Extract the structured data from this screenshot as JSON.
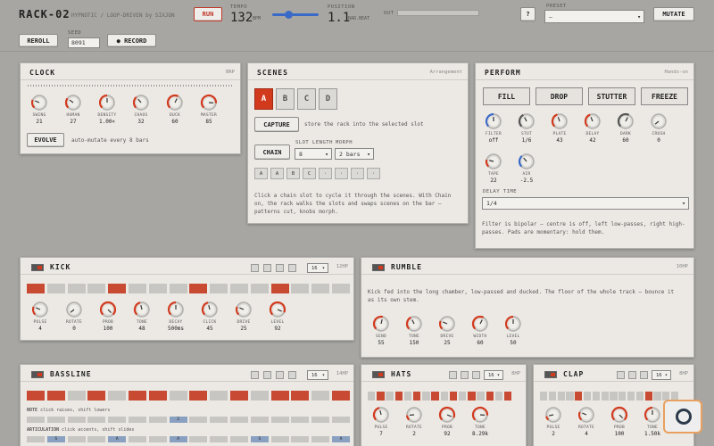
{
  "header": {
    "title": "RACK-02",
    "subtitle": "HYPNOTIC / LOOP-DRIVEN by SIXJON",
    "run_label": "RUN",
    "tempo_label": "TEMPO",
    "tempo_value": "132",
    "tempo_unit": "BPM",
    "position_label": "POSITION",
    "position_value": "1.1",
    "position_unit": "BAR.BEAT",
    "out_label": "OUT",
    "help_label": "?",
    "preset_label": "PRESET",
    "preset_value": "—",
    "mutate_label": "MUTATE",
    "reroll_label": "REROLL",
    "seed_label": "SEED",
    "seed_value": "8091",
    "record_label": "● RECORD"
  },
  "clock": {
    "title": "CLOCK",
    "tag": "BRP",
    "knobs": [
      {
        "label": "SWING",
        "value": "21",
        "level": 0.25
      },
      {
        "label": "HUMAN",
        "value": "27",
        "level": 0.3
      },
      {
        "label": "DENSITY",
        "value": "1.00×",
        "level": 0.5
      },
      {
        "label": "CHAOS",
        "value": "32",
        "level": 0.35
      },
      {
        "label": "DUCK",
        "value": "60",
        "level": 0.6
      },
      {
        "label": "MASTER",
        "value": "85",
        "level": 0.85
      }
    ],
    "evolve_label": "EVOLVE",
    "evolve_text": "auto-mutate every 8 bars"
  },
  "scenes": {
    "title": "SCENES",
    "tag": "Arrangement",
    "buttons": [
      "A",
      "B",
      "C",
      "D"
    ],
    "capture_label": "CAPTURE",
    "capture_text": "store the rack into the selected slot",
    "chain_label": "CHAIN",
    "slot_length_label": "SLOT LENGTH",
    "slot_length_value": "8",
    "morph_label": "MORPH",
    "morph_value": "2 bars",
    "slots": [
      "A",
      "A",
      "B",
      "C",
      "·",
      "·",
      "·",
      "·"
    ],
    "help": "Click a chain slot to cycle it through the scenes. With Chain on, the rack walks the slots and swaps scenes on the bar — patterns cut, knobs morph."
  },
  "perform": {
    "title": "PERFORM",
    "tag": "Hands-on",
    "pads": [
      "FILL",
      "DROP",
      "STUTTER",
      "FREEZE"
    ],
    "knobs": [
      {
        "label": "FILTER",
        "value": "off",
        "level": 0.5,
        "color": "#3a6ac8"
      },
      {
        "label": "STUT",
        "value": "1/6",
        "level": 0.4,
        "color": "#555555"
      },
      {
        "label": "PLATE",
        "value": "43",
        "level": 0.43,
        "color": "#d23a1e"
      },
      {
        "label": "DELAY",
        "value": "42",
        "level": 0.42,
        "color": "#d23a1e"
      },
      {
        "label": "DARK",
        "value": "60",
        "level": 0.6,
        "color": "#555555"
      },
      {
        "label": "CRUSH",
        "value": "0",
        "level": 0.02,
        "color": "#555555"
      },
      {
        "label": "TAPE",
        "value": "22",
        "level": 0.22,
        "color": "#d23a1e"
      },
      {
        "label": "AIR",
        "value": "-2.5",
        "level": 0.35,
        "color": "#3a6ac8"
      }
    ],
    "delay_time_label": "DELAY TIME",
    "delay_time_value": "1/4",
    "help": "Filter is bipolar — centre is off, left low-passes, right high-passes. Pads are momentary: hold them."
  },
  "kick": {
    "title": "KICK",
    "tag": "12HP",
    "steps_select": "16",
    "steps": [
      1,
      0,
      0,
      0,
      1,
      0,
      0,
      0,
      1,
      0,
      0,
      0,
      1,
      0,
      0,
      0
    ],
    "knobs": [
      {
        "label": "PULSE",
        "value": "4",
        "level": 0.25
      },
      {
        "label": "ROTATE",
        "value": "0",
        "level": 0.02
      },
      {
        "label": "PROB",
        "value": "100",
        "level": 1.0
      },
      {
        "label": "TONE",
        "value": "48",
        "level": 0.45
      },
      {
        "label": "DECAY",
        "value": "500ms",
        "level": 0.5
      },
      {
        "label": "CLICK",
        "value": "45",
        "level": 0.45
      },
      {
        "label": "DRIVE",
        "value": "25",
        "level": 0.25
      },
      {
        "label": "LEVEL",
        "value": "92",
        "level": 0.92
      }
    ]
  },
  "rumble": {
    "title": "RUMBLE",
    "tag": "10HP",
    "text": "Kick fed into the long chamber, low-passed and ducked. The floor of the whole track — bounce it as its own stem.",
    "knobs": [
      {
        "label": "SEND",
        "value": "55",
        "level": 0.55
      },
      {
        "label": "TONE",
        "value": "150",
        "level": 0.4
      },
      {
        "label": "DRIVE",
        "value": "25",
        "level": 0.25
      },
      {
        "label": "WIDTH",
        "value": "60",
        "level": 0.6
      },
      {
        "label": "LEVEL",
        "value": "50",
        "level": 0.5
      }
    ]
  },
  "bassline": {
    "title": "BASSLINE",
    "tag": "14HP",
    "steps_select": "16",
    "steps": [
      1,
      1,
      0,
      1,
      0,
      1,
      1,
      0,
      1,
      0,
      1,
      0,
      1,
      1,
      0,
      1
    ],
    "note_label": "NOTE",
    "note_hint": "click raises, shift lowers",
    "note_row": [
      "",
      "",
      "",
      "",
      "",
      "",
      "",
      "2",
      "",
      "",
      "",
      "",
      "",
      "",
      "",
      ""
    ],
    "artic_label": "ARTICULATION",
    "artic_hint": "click accents, shift slides",
    "artic_row": [
      "",
      "S",
      "",
      "",
      "A",
      "",
      "",
      "A",
      "",
      "",
      "",
      "S",
      "",
      "",
      "",
      "A"
    ]
  },
  "hats": {
    "title": "HATS",
    "tag": "8HP",
    "steps_select": "16",
    "steps": [
      0,
      1,
      0,
      1,
      0,
      1,
      0,
      1,
      0,
      1,
      0,
      1,
      0,
      1,
      0,
      1
    ],
    "knobs": [
      {
        "label": "PULSE",
        "value": "7",
        "level": 0.45
      },
      {
        "label": "ROTATE",
        "value": "2",
        "level": 0.15
      },
      {
        "label": "PROB",
        "value": "92",
        "level": 0.92
      },
      {
        "label": "TONE",
        "value": "8.29k",
        "level": 0.85
      }
    ]
  },
  "clap": {
    "title": "CLAP",
    "tag": "8HP",
    "steps_select": "16",
    "steps": [
      0,
      0,
      0,
      0,
      1,
      0,
      0,
      0,
      0,
      0,
      0,
      0,
      1,
      0,
      0,
      0
    ],
    "knobs": [
      {
        "label": "PULSE",
        "value": "2",
        "level": 0.12
      },
      {
        "label": "ROTATE",
        "value": "4",
        "level": 0.25
      },
      {
        "label": "PROB",
        "value": "100",
        "level": 1.0
      },
      {
        "label": "TONE",
        "value": "1.50k",
        "level": 0.5
      }
    ]
  },
  "colors": {
    "accent": "#d23a1e",
    "blue": "#3a6ac8",
    "panel": "#ece9e4"
  }
}
